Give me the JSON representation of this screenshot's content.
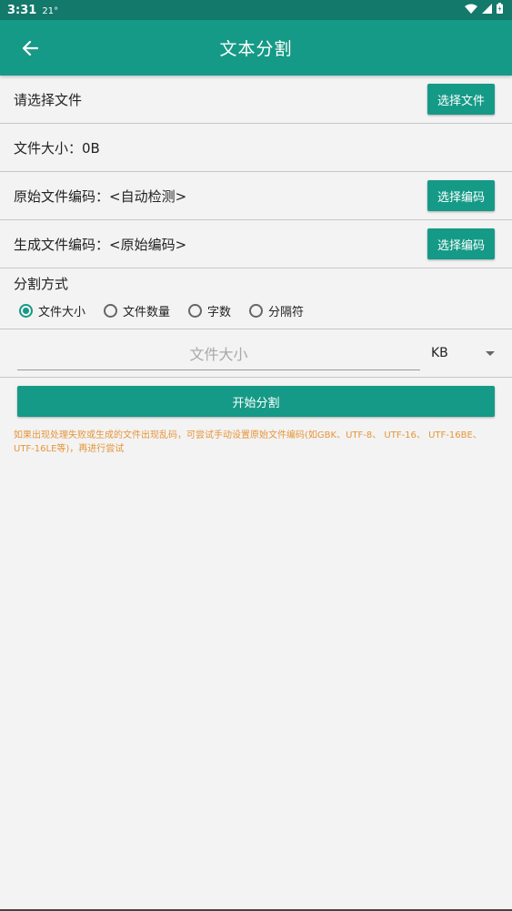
{
  "status": {
    "time": "3:31",
    "temp": "21°"
  },
  "appbar": {
    "title": "文本分割"
  },
  "file_row": {
    "label": "请选择文件",
    "button": "选择文件"
  },
  "size_row": {
    "label": "文件大小：0B"
  },
  "origin_row": {
    "label": "原始文件编码：<自动检测>",
    "button": "选择编码"
  },
  "gen_row": {
    "label": "生成文件编码：<原始编码>",
    "button": "选择编码"
  },
  "split": {
    "title": "分割方式",
    "options": [
      "文件大小",
      "文件数量",
      "字数",
      "分隔符"
    ],
    "selected": "文件大小"
  },
  "size_input": {
    "placeholder": "文件大小",
    "value": ""
  },
  "unit": {
    "value": "KB"
  },
  "start_button": "开始分割",
  "hint": "如果出现处理失败或生成的文件出现乱码，可尝试手动设置原始文件编码(如GBK、UTF-8、 UTF-16、 UTF-16BE、 UTF-16LE等)，再进行尝试",
  "colors": {
    "primary": "#159a87",
    "status": "#12796b",
    "hint": "#e6953a"
  },
  "icons": {
    "back": "arrow-left-icon",
    "wifi": "wifi-icon",
    "signal": "signal-icon",
    "battery": "battery-icon",
    "dropdown": "caret-down-icon"
  }
}
